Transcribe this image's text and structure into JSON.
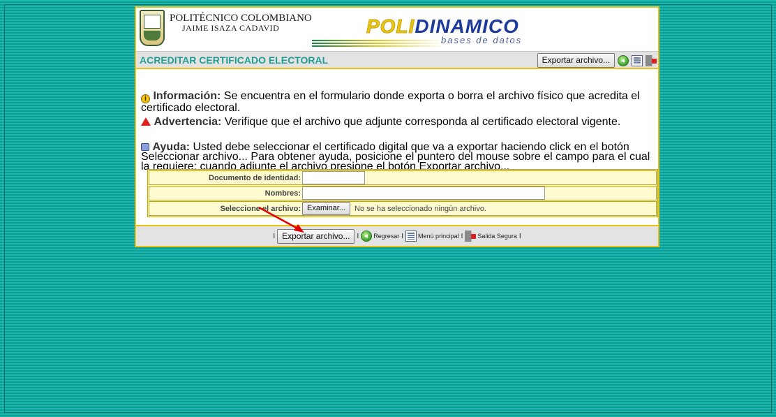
{
  "header": {
    "institution_line1": "POLITÉCNICO COLOMBIANO",
    "institution_line2": "JAIME ISAZA CADAVID",
    "logo_part1": "POLI",
    "logo_part2": "DINAMICO",
    "logo_subtitle": "bases de datos"
  },
  "titlebar": {
    "page_title": "ACREDITAR CERTIFICADO ELECTORAL",
    "export_label": "Exportar archivo...",
    "icons": [
      "back-icon",
      "menu-icon",
      "exit-icon"
    ]
  },
  "messages": {
    "info_label": "Información:",
    "info_text": " Se encuentra en el formulario donde exporta o borra el archivo físico que acredita el certificado electoral.",
    "warning_label": "Advertencia:",
    "warning_text": " Verifique que el archivo que adjunte corresponda al certificado electoral vigente.",
    "help_label": "Ayuda:",
    "help_text": " Usted debe seleccionar el certificado digital que va a exportar haciendo click en el botón Seleccionar archivo... Para obtener ayuda, posicione el puntero del mouse sobre el campo para el cual la requiere; cuando adjunte el archivo presione el botón Exportar archivo..."
  },
  "form": {
    "id_label": "Documento de identidad:",
    "id_value": "",
    "names_label": "Nombres:",
    "names_value": "",
    "file_label": "Seleccione el archivo:",
    "browse_label": "Examinar...",
    "file_status": "No se ha seleccionado ningún archivo."
  },
  "footer": {
    "separator": "I",
    "export_label": "Exportar archivo...",
    "back_label": "Regresar",
    "menu_label": "Menú principal",
    "exit_label": "Salida Segura"
  },
  "colors": {
    "background": "#12aaa0",
    "panel_border": "#e7c21a",
    "title": "#1f9e94",
    "form_background": "#fdfbcf",
    "annotation_arrow": "#e00000"
  }
}
